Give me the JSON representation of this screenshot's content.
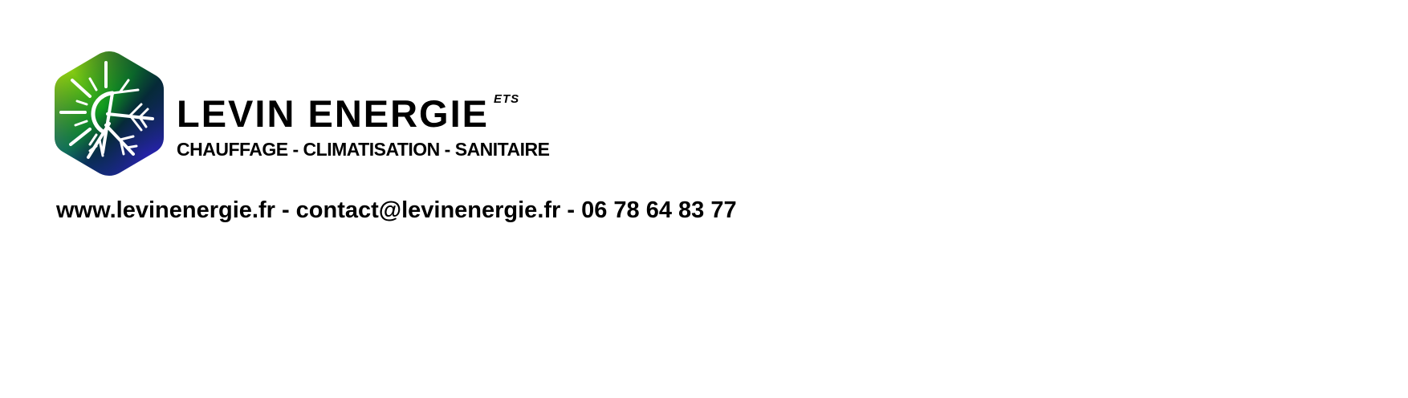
{
  "brand": {
    "name": "LEVIN ENERGIE",
    "tag": "ETS",
    "tagline": "CHAUFFAGE - CLIMATISATION - SANITAIRE"
  },
  "logo": {
    "icon": "sun-snowflake-hexagon-icon",
    "colors": {
      "gradient_start": "#c6e60b",
      "gradient_mid": "#0f9a1f",
      "gradient_dark": "#062a38",
      "gradient_end": "#3a1df2",
      "symbol": "#ffffff"
    }
  },
  "contact_line": "www.levinenergie.fr - contact@levinenergie.fr - 06 78 64 83 77"
}
